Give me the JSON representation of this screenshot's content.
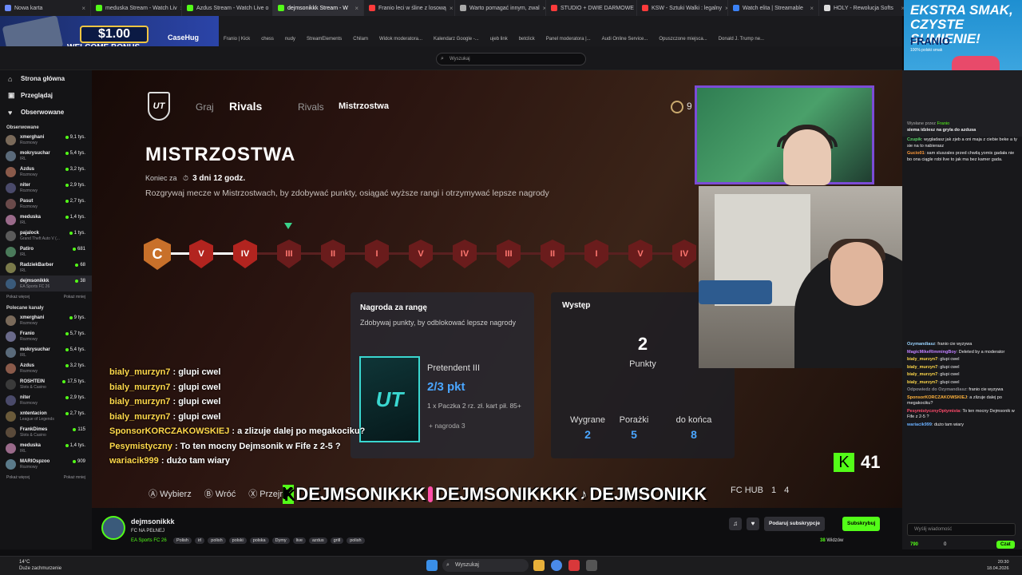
{
  "browser": {
    "tabs": [
      {
        "label": "Nowa karta",
        "color": "#6c8cff"
      },
      {
        "label": "meduska Stream - Watch Liv",
        "color": "#53fc18"
      },
      {
        "label": "Azdus Stream - Watch Live o",
        "color": "#53fc18"
      },
      {
        "label": "dejmsonikkk Stream - W",
        "color": "#53fc18",
        "active": true
      },
      {
        "label": "Franio leci w śline z losową",
        "color": "#ff3b3b"
      },
      {
        "label": "Warto pomagać innym, zwal",
        "color": "#aaaaaa"
      },
      {
        "label": "STUDIO + DWIE DARMOWE",
        "color": "#ff3b3b"
      },
      {
        "label": "KSW - Sztuki Walki : legalny",
        "color": "#ff3b3b"
      },
      {
        "label": "Watch elita | Streamable",
        "color": "#3b82f6"
      },
      {
        "label": "HOLY - Rewolucja Softs",
        "color": "#dddddd"
      }
    ],
    "bookmarks": [
      "Franio | Kick",
      "chess",
      "nudy",
      "StreamElements",
      "Chilam",
      "Widok moderatora...",
      "Kalendarz Google -...",
      "ujeb link",
      "betclick",
      "Panel moderatora |...",
      "Audi Online Service...",
      "Opuszczone miejsca...",
      "Donald J. Trump ne..."
    ]
  },
  "promo": {
    "amount": "$1.00",
    "text": "WELCOME BONUS",
    "brand": "CaseHug"
  },
  "search": {
    "placeholder": "Wyszukaj"
  },
  "sidebar": {
    "nav": [
      {
        "label": "Strona główna",
        "icon": "home-icon",
        "glyph": "⌂"
      },
      {
        "label": "Przeglądaj",
        "icon": "browse-icon",
        "glyph": "▣"
      },
      {
        "label": "Obserwowane",
        "icon": "heart-icon",
        "glyph": "♥"
      }
    ],
    "followed_title": "Obserwowane",
    "followed": [
      {
        "name": "xmerghani",
        "cat": "Rozmowy",
        "viewers": "9,1 tys.",
        "color": "#7a6a5a"
      },
      {
        "name": "mokrysuchar",
        "cat": "IRL",
        "viewers": "5,4 tys.",
        "color": "#5a6a7a"
      },
      {
        "name": "Azdus",
        "cat": "Rozmowy",
        "viewers": "3,2 tys.",
        "color": "#8a5a4a"
      },
      {
        "name": "niter",
        "cat": "Rozmowy",
        "viewers": "2,9 tys.",
        "color": "#4a4a6a"
      },
      {
        "name": "Pasut",
        "cat": "Rozmowy",
        "viewers": "2,7 tys.",
        "color": "#6a4a4a"
      },
      {
        "name": "meduska",
        "cat": "IRL",
        "viewers": "1,4 tys.",
        "color": "#9a6a8a"
      },
      {
        "name": "pajalock",
        "cat": "Grand Theft Auto V (...",
        "viewers": "1 tys.",
        "color": "#5a5a5a"
      },
      {
        "name": "Patiro",
        "cat": "IRL",
        "viewers": "681",
        "color": "#4a7a5a"
      },
      {
        "name": "RadziekBarber",
        "cat": "IRL",
        "viewers": "68",
        "color": "#7a7a4a"
      },
      {
        "name": "dejmsonikkk",
        "cat": "EA Sports FC 26",
        "viewers": "38",
        "color": "#3a5a7a",
        "active": true
      }
    ],
    "more": "Pokaż więcej",
    "less": "Pokaż mniej",
    "recommended_title": "Polecane kanały",
    "recommended": [
      {
        "name": "xmerghani",
        "cat": "Rozmowy",
        "viewers": "9 tys.",
        "color": "#7a6a5a"
      },
      {
        "name": "Franio",
        "cat": "Rozmowy",
        "viewers": "5,7 tys.",
        "color": "#6a6a8a"
      },
      {
        "name": "mokrysuchar",
        "cat": "IRL",
        "viewers": "5,4 tys.",
        "color": "#5a6a7a"
      },
      {
        "name": "Azdus",
        "cat": "Rozmowy",
        "viewers": "3,2 tys.",
        "color": "#8a5a4a"
      },
      {
        "name": "ROSHTEIN",
        "cat": "Slots & Casino",
        "viewers": "17,5 tys.",
        "color": "#3a3a3a"
      },
      {
        "name": "niter",
        "cat": "Rozmowy",
        "viewers": "2,9 tys.",
        "color": "#4a4a6a"
      },
      {
        "name": "xntentacion",
        "cat": "League of Legends",
        "viewers": "2,7 tys.",
        "color": "#6a5a3a"
      },
      {
        "name": "FrankDimes",
        "cat": "Slots & Casino",
        "viewers": "115",
        "color": "#5a4a3a"
      },
      {
        "name": "meduska",
        "cat": "IRL",
        "viewers": "1,4 tys.",
        "color": "#9a6a8a"
      },
      {
        "name": "MARIOspzoo",
        "cat": "Rozmowy",
        "viewers": "909",
        "color": "#5a7a8a"
      }
    ]
  },
  "game": {
    "tabs": {
      "play": "Graj",
      "rivals": "Rivals",
      "rivals2": "Rivals",
      "champs": "Mistrzostwa"
    },
    "points_badge": "9",
    "title": "MISTRZOSTWA",
    "ends_label": "Koniec za",
    "ends_value": "3 dni 12 godz.",
    "description": "Rozgrywaj mecze w Mistrzostwach, by zdobywać punkty, osiągać wyższe rangi i otrzymywać lepsze nagrody",
    "ranks": [
      "C",
      "V",
      "IV",
      "III",
      "II",
      "I",
      "V",
      "IV",
      "III",
      "II",
      "I",
      "V",
      "IV"
    ],
    "current_rank_index": 3,
    "reward": {
      "title": "Nagroda za rangę",
      "subtitle": "Zdobywaj punkty, by odblokować lepsze nagrody",
      "rank_name": "Pretendent III",
      "progress": "2/3 pkt",
      "items": "1 x Paczka 2 rz. zł. kart pił. 85+",
      "more": "+ nagroda 3",
      "card_logo": "UT"
    },
    "performance": {
      "title": "Występ",
      "points": "2",
      "points_label": "Punkty",
      "wins_label": "Wygrane",
      "wins": "2",
      "losses_label": "Porażki",
      "losses": "5",
      "left_label": "do końca",
      "left": "8"
    },
    "controls": {
      "select": "Wybierz",
      "back": "Wróć",
      "browse": "Przejrzyj",
      "hub": "FC HUB",
      "count1": "1",
      "count2": "4"
    },
    "kick_count": "41"
  },
  "overlay_chat": [
    {
      "user": "bialy_murzyn7",
      "msg": "glupi cwel"
    },
    {
      "user": "bialy_murzyn7",
      "msg": "glupi cwel"
    },
    {
      "user": "bialy_murzyn7",
      "msg": "glupi cwel"
    },
    {
      "user": "bialy_murzyn7",
      "msg": "glupi cwel"
    },
    {
      "user": "SponsorKORCZAKOWSKIEJ",
      "msg": "a zlizuje dalej po megakociku?"
    },
    {
      "user": "Pesymistyczny",
      "msg": "To ten mocny Dejmsonik w Fife z 2-5 ?"
    },
    {
      "user": "wariacik999",
      "msg": "dużo tam wiary"
    }
  ],
  "banner": {
    "k": "K",
    "text1": "DEJMSONIKKK",
    "text2": "DEJMSONIKKKK",
    "text3": "DEJMSONIKK"
  },
  "streamer": {
    "name": "dejmsonikkk",
    "title": "FC NA PEŁNEJ",
    "category": "EA Sports FC 26",
    "tags": [
      "Polish",
      "irl",
      "polish",
      "polski",
      "polska",
      "Dymy",
      "live",
      "azdus",
      "grill",
      "polish"
    ],
    "viewers": "38",
    "viewers_label": "Widzów",
    "gift": "Podaruj subskrypcje",
    "subscribe": "Subskrybuj"
  },
  "chat": {
    "pinned_by": "Wysłane przez",
    "pinned_user": "Franio",
    "pinned_msg": "siema idziesz na gryla do azdusa",
    "messages": [
      {
        "user": "Czupik",
        "color": "#5bd46a",
        "msg": "wygladasz jak zjeb a oni maja z ciebie beke a ty sie na to nabierasz"
      },
      {
        "user": "Gucio01",
        "color": "#ff9a3b",
        "msg": "sam sluszales przed chwilą yomis gadała nie bo ona ciągle robi live to jak ma bez kamer gada."
      },
      {
        "user": "Ozymandiasz",
        "color": "#9ad4ff",
        "msg": "franio cie wyzywa"
      },
      {
        "user": "MagicMikeRimmingBoy",
        "color": "#c080ff",
        "msg": "Deleted by a moderator"
      },
      {
        "user": "bialy_murzyn7",
        "color": "#ffd84a",
        "msg": "glupi cwel"
      },
      {
        "user": "bialy_murzyn7",
        "color": "#ffd84a",
        "msg": "glupi cwel"
      },
      {
        "user": "bialy_murzyn7",
        "color": "#ffd84a",
        "msg": "glupi cwel"
      },
      {
        "user": "bialy_murzyn7",
        "color": "#ffd84a",
        "msg": "glupi cwel"
      },
      {
        "user": "Odpowiedz do Ozymandiasz",
        "color": "#8a8a90",
        "msg": "franio cie wyzywa"
      },
      {
        "user": "SponsorKORCZAKOWSKIEJ",
        "color": "#ffb23b",
        "msg": "a zlizuje dalej po megakociku?"
      },
      {
        "user": "PesymistycznyOptymista",
        "color": "#ff4a6a",
        "msg": "To ten mocny Dejmsonik w Fife z 2-5 ?"
      },
      {
        "user": "wariacik999",
        "color": "#6ab0ff",
        "msg": "dużo tam wiary"
      }
    ],
    "input_placeholder": "Wyślij wiadomość",
    "points": "790",
    "zero": "0",
    "send": "Czat"
  },
  "ad": {
    "line1": "EKSTRA SMAK,",
    "line2": "CZYSTE SUMIENIE!",
    "brand": "FRANIO",
    "small": "100% polski smak"
  },
  "taskbar": {
    "weather_temp": "14°C",
    "weather_desc": "Duże zachmurzenie",
    "search": "Wyszukaj",
    "time": "20:30",
    "date": "18.04.2026"
  }
}
